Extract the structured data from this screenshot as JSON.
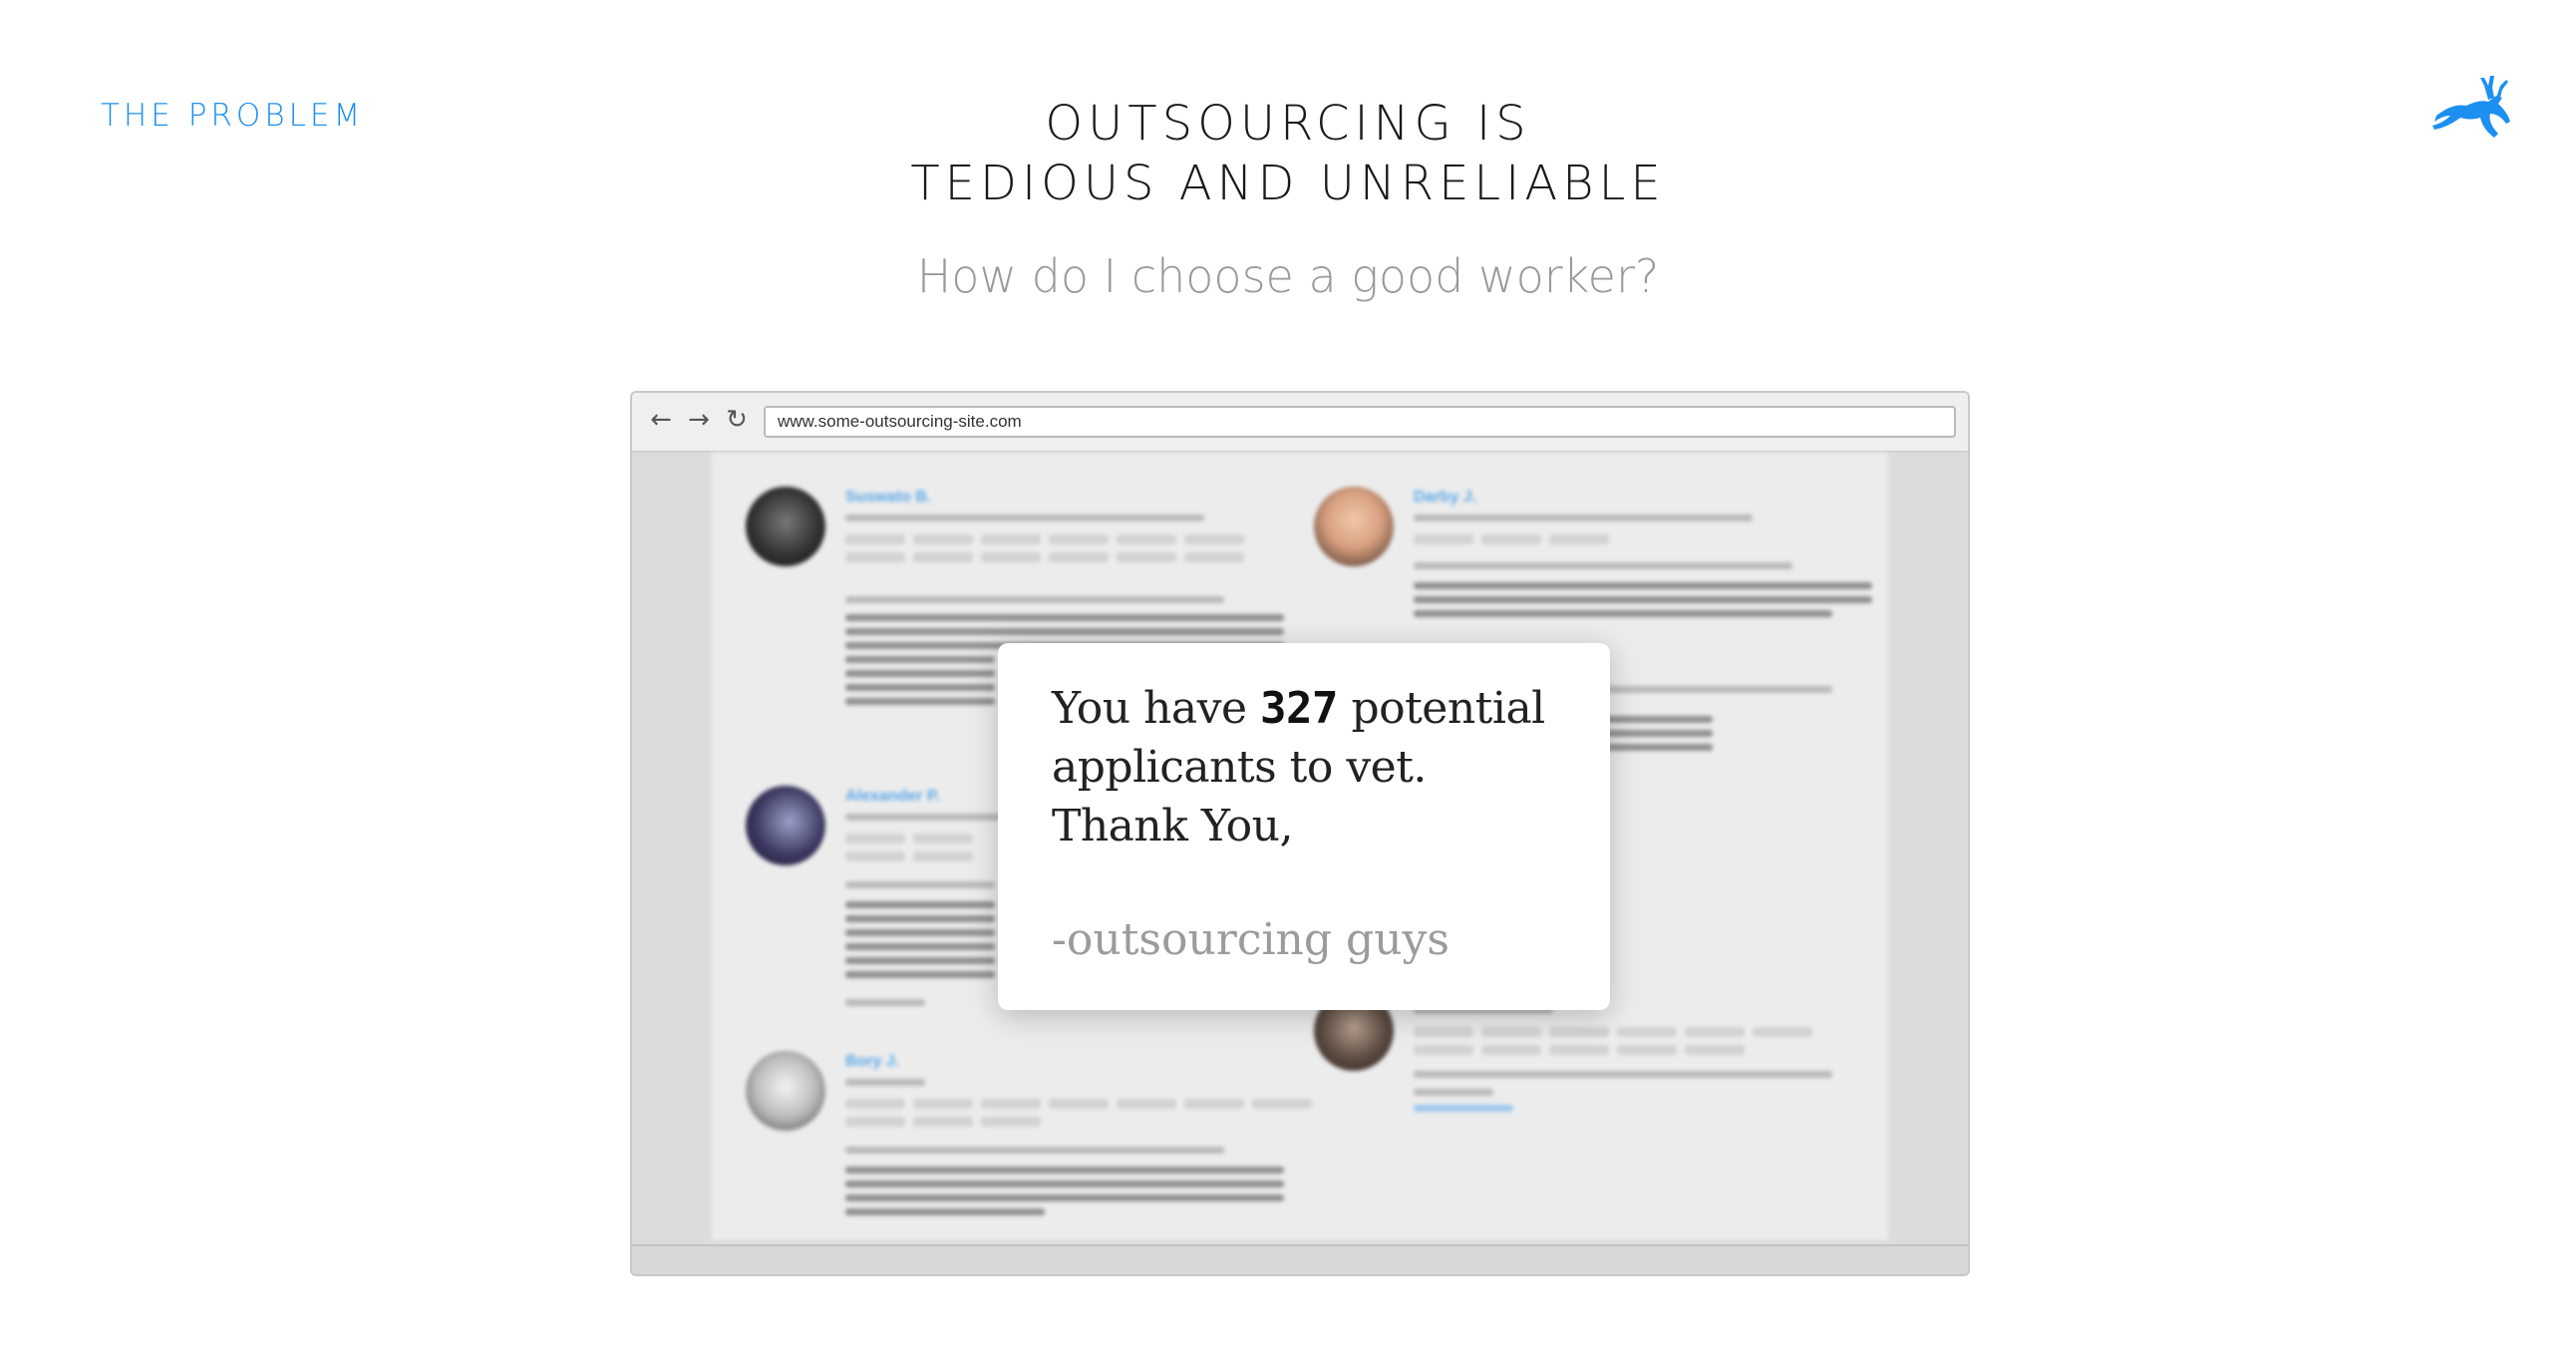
{
  "section_label": "THE PROBLEM",
  "title": {
    "line1": "OUTSOURCING IS",
    "line2": "TEDIOUS AND UNRELIABLE"
  },
  "subtitle": "How do I choose a good worker?",
  "browser": {
    "url": "www.some-outsourcing-site.com",
    "nav": {
      "back": "←",
      "forward": "→",
      "reload": "↻"
    }
  },
  "profiles": [
    {
      "name": "Suswato B."
    },
    {
      "name": "Darby J."
    },
    {
      "name": "Alexander P."
    },
    {
      "name": "Bory J."
    }
  ],
  "dialog": {
    "line1_before": "You have ",
    "count": "327",
    "line1_after": " potential",
    "line2": "applicants to vet.",
    "line3": "Thank You,",
    "signature": "-outsourcing guys"
  },
  "colors": {
    "accent": "#1d8ff0"
  },
  "icons": {
    "logo": "leaping-deer-logo-icon"
  }
}
